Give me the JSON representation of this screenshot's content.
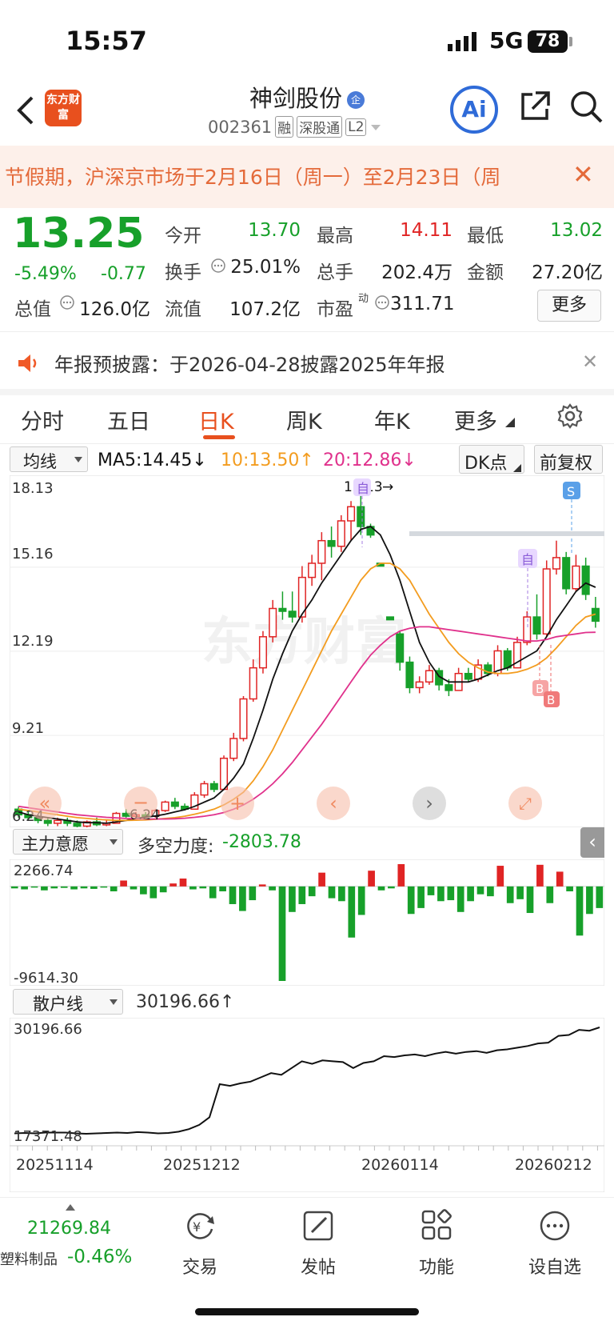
{
  "status": {
    "time": "15:57",
    "network": "5G",
    "battery": "78"
  },
  "header": {
    "logo": "东方财富",
    "title": "神剑股份",
    "badge": "企",
    "code": "002361",
    "tags": [
      "融",
      "深股通",
      "L2"
    ],
    "ai": "Ai"
  },
  "banner": {
    "text": "节假期，沪深京市场于2月16日（周一）至2月23日（周",
    "close": "✕"
  },
  "quote": {
    "price": "13.25",
    "pct": "-5.49%",
    "chg": "-0.77",
    "rows": [
      [
        {
          "k": "今开",
          "v": "13.70",
          "c": "#17a02a"
        },
        {
          "k": "最高",
          "v": "14.11",
          "c": "#e02424"
        },
        {
          "k": "最低",
          "v": "13.02",
          "c": "#17a02a"
        }
      ],
      [
        {
          "k": "换手",
          "v": "25.01%",
          "c": "#222"
        },
        {
          "k": "总手",
          "v": "202.4万",
          "c": "#222"
        },
        {
          "k": "金额",
          "v": "27.20亿",
          "c": "#222"
        }
      ],
      [
        {
          "k": "总值",
          "v": "126.0亿",
          "c": "#222"
        },
        {
          "k": "流值",
          "v": "107.2亿",
          "c": "#222"
        },
        {
          "k": "市盈",
          "v": "311.71",
          "c": "#222"
        }
      ]
    ],
    "more": "更多",
    "pe_sup": "动"
  },
  "announcement": {
    "text": "年报预披露：于2026-04-28披露2025年年报",
    "close": "✕"
  },
  "tabs": [
    "分时",
    "五日",
    "日K",
    "周K",
    "年K",
    "更多"
  ],
  "ma_bar": {
    "selector": "均线",
    "ma5": "MA5:14.45",
    "ma5_arrow": "↓",
    "ma10": "10:13.50",
    "ma10_arrow": "↑",
    "ma20": "20:12.86",
    "ma20_arrow": "↓",
    "dk": "DK点",
    "fq": "前复权"
  },
  "kchart": {
    "y_labels": [
      "18.13",
      "15.16",
      "12.19",
      "9.21",
      "6.24"
    ],
    "high_label": "18.13",
    "low_label": "6.24",
    "watermark": "东方财富",
    "signals": [
      "自",
      "自",
      "S",
      "B",
      "B"
    ]
  },
  "ind1": {
    "selector": "主力意愿",
    "label": "多空力度:",
    "value": "-2803.78",
    "max": "2266.74",
    "min": "-9614.30"
  },
  "ind2": {
    "selector": "散户线",
    "value": "30196.66",
    "arrow": "↑",
    "max": "30196.66",
    "min": "17371.48"
  },
  "dates": [
    "20251114",
    "20251212",
    "20260114",
    "20260212"
  ],
  "footer": {
    "index_value": "21269.84",
    "index_name": "塑料制品",
    "index_pct": "-0.46%",
    "items": [
      "交易",
      "发帖",
      "功能",
      "设自选"
    ]
  },
  "colors": {
    "up": "#e02424",
    "down": "#17a02a",
    "accent": "#e8501e",
    "ma5": "#111111",
    "ma10": "#f39c1f",
    "ma20": "#e0318c"
  },
  "chart_data": {
    "type": "candlestick",
    "ohlc": [
      [
        6.6,
        6.7,
        6.3,
        6.4
      ],
      [
        6.4,
        6.5,
        6.2,
        6.3
      ],
      [
        6.3,
        6.4,
        6.1,
        6.2
      ],
      [
        6.2,
        6.3,
        6.0,
        6.1
      ],
      [
        6.1,
        6.3,
        6.0,
        6.2
      ],
      [
        6.2,
        6.3,
        6.0,
        6.1
      ],
      [
        6.1,
        6.2,
        5.9,
        6.0
      ],
      [
        6.0,
        6.2,
        5.9,
        6.15
      ],
      [
        6.15,
        6.3,
        6.0,
        6.05
      ],
      [
        6.05,
        6.2,
        6.0,
        6.1
      ],
      [
        6.1,
        6.5,
        6.1,
        6.45
      ],
      [
        6.45,
        6.6,
        6.3,
        6.35
      ],
      [
        6.35,
        6.5,
        6.25,
        6.4
      ],
      [
        6.4,
        6.5,
        6.3,
        6.35
      ],
      [
        6.35,
        6.6,
        6.3,
        6.55
      ],
      [
        6.55,
        6.9,
        6.5,
        6.85
      ],
      [
        6.85,
        7.0,
        6.6,
        6.7
      ],
      [
        6.7,
        6.8,
        6.55,
        6.6
      ],
      [
        6.6,
        7.2,
        6.6,
        7.1
      ],
      [
        7.1,
        7.6,
        7.0,
        7.5
      ],
      [
        7.5,
        7.6,
        7.2,
        7.3
      ],
      [
        7.3,
        8.5,
        7.3,
        8.4
      ],
      [
        8.4,
        9.3,
        8.3,
        9.1
      ],
      [
        9.1,
        10.6,
        9.0,
        10.5
      ],
      [
        10.5,
        11.9,
        10.4,
        11.6
      ],
      [
        11.6,
        12.9,
        11.4,
        12.7
      ],
      [
        12.7,
        14.0,
        12.5,
        13.7
      ],
      [
        13.7,
        14.3,
        13.3,
        13.6
      ],
      [
        13.6,
        14.3,
        13.2,
        13.4
      ],
      [
        13.4,
        15.2,
        13.2,
        14.8
      ],
      [
        14.8,
        15.6,
        14.5,
        15.3
      ],
      [
        15.3,
        16.4,
        14.7,
        16.1
      ],
      [
        16.1,
        16.6,
        15.5,
        15.9
      ],
      [
        15.9,
        17.0,
        15.7,
        16.8
      ],
      [
        16.8,
        17.5,
        16.1,
        17.3
      ],
      [
        17.3,
        18.13,
        16.3,
        16.6
      ],
      [
        16.6,
        16.7,
        16.2,
        16.3
      ],
      [
        15.3,
        15.3,
        15.2,
        15.2
      ],
      [
        13.4,
        13.4,
        13.3,
        13.3
      ],
      [
        12.8,
        12.9,
        11.5,
        11.8
      ],
      [
        11.8,
        12.0,
        10.7,
        10.9
      ],
      [
        10.9,
        11.3,
        10.7,
        11.1
      ],
      [
        11.1,
        11.7,
        11.0,
        11.5
      ],
      [
        11.5,
        11.6,
        10.8,
        11.0
      ],
      [
        11.0,
        11.2,
        10.6,
        10.8
      ],
      [
        10.8,
        11.6,
        10.8,
        11.4
      ],
      [
        11.4,
        11.6,
        11.1,
        11.2
      ],
      [
        11.2,
        11.9,
        11.1,
        11.7
      ],
      [
        11.7,
        11.8,
        11.3,
        11.4
      ],
      [
        11.4,
        12.4,
        11.3,
        12.2
      ],
      [
        12.2,
        12.3,
        11.5,
        11.6
      ],
      [
        11.6,
        12.7,
        11.6,
        12.5
      ],
      [
        12.5,
        13.6,
        12.4,
        13.4
      ],
      [
        13.4,
        14.2,
        12.6,
        12.8
      ],
      [
        12.8,
        15.4,
        12.7,
        15.1
      ],
      [
        15.1,
        16.1,
        14.9,
        15.5
      ],
      [
        15.5,
        15.7,
        14.2,
        14.4
      ],
      [
        14.4,
        15.6,
        14.3,
        15.2
      ],
      [
        15.2,
        15.5,
        14.0,
        14.2
      ],
      [
        13.7,
        14.11,
        13.02,
        13.25
      ]
    ],
    "ma5": [
      6.5,
      6.4,
      6.35,
      6.3,
      6.25,
      6.2,
      6.15,
      6.12,
      6.12,
      6.1,
      6.15,
      6.2,
      6.27,
      6.32,
      6.36,
      6.42,
      6.5,
      6.58,
      6.7,
      6.85,
      7.0,
      7.3,
      7.7,
      8.2,
      9.1,
      10.1,
      11.2,
      12.1,
      12.9,
      13.5,
      14.0,
      14.6,
      15.1,
      15.6,
      16.1,
      16.5,
      16.6,
      16.3,
      15.6,
      14.7,
      13.6,
      12.5,
      11.8,
      11.3,
      11.1,
      11.1,
      11.1,
      11.2,
      11.35,
      11.5,
      11.6,
      11.8,
      12.0,
      12.2,
      12.7,
      13.3,
      13.8,
      14.3,
      14.6,
      14.45
    ],
    "ma10": [
      6.6,
      6.55,
      6.5,
      6.45,
      6.4,
      6.35,
      6.3,
      6.27,
      6.24,
      6.22,
      6.2,
      6.2,
      6.21,
      6.22,
      6.24,
      6.27,
      6.3,
      6.35,
      6.42,
      6.5,
      6.6,
      6.75,
      6.95,
      7.2,
      7.6,
      8.1,
      8.7,
      9.4,
      10.1,
      10.8,
      11.5,
      12.2,
      12.9,
      13.5,
      14.1,
      14.7,
      15.1,
      15.3,
      15.3,
      15.1,
      14.7,
      14.1,
      13.5,
      13.0,
      12.5,
      12.1,
      11.8,
      11.6,
      11.45,
      11.4,
      11.4,
      11.45,
      11.55,
      11.7,
      11.95,
      12.3,
      12.7,
      13.1,
      13.4,
      13.5
    ],
    "ma20": [
      6.7,
      6.65,
      6.6,
      6.55,
      6.5,
      6.45,
      6.4,
      6.37,
      6.34,
      6.31,
      6.29,
      6.27,
      6.26,
      6.25,
      6.25,
      6.25,
      6.26,
      6.28,
      6.31,
      6.35,
      6.4,
      6.48,
      6.6,
      6.75,
      6.95,
      7.2,
      7.5,
      7.85,
      8.25,
      8.7,
      9.15,
      9.6,
      10.1,
      10.6,
      11.1,
      11.6,
      12.05,
      12.4,
      12.7,
      12.9,
      13.0,
      13.05,
      13.05,
      13.0,
      12.95,
      12.9,
      12.85,
      12.8,
      12.75,
      12.7,
      12.65,
      12.6,
      12.55,
      12.55,
      12.6,
      12.7,
      12.75,
      12.8,
      12.85,
      12.86
    ],
    "main_force": [
      -200,
      -300,
      -100,
      -400,
      -200,
      -150,
      -300,
      -200,
      -250,
      -100,
      -500,
      600,
      -300,
      -800,
      -1200,
      -600,
      300,
      800,
      -300,
      -200,
      -1200,
      -500,
      -1800,
      -2500,
      -1400,
      200,
      -400,
      -9614,
      -2600,
      -1800,
      -1000,
      1400,
      -1200,
      -1500,
      -5200,
      -2900,
      1600,
      -400,
      -200,
      2266,
      -2800,
      -2200,
      -900,
      -1500,
      -1400,
      -2600,
      -1500,
      -800,
      -1000,
      2100,
      -1700,
      -1300,
      -2700,
      2200,
      -1700,
      1500,
      -500,
      -5000,
      -2800,
      -2200
    ],
    "retail": [
      17700,
      17750,
      17700,
      17800,
      17800,
      17800,
      17700,
      17650,
      17700,
      17750,
      17800,
      17750,
      17850,
      17800,
      17700,
      17750,
      17900,
      18200,
      18700,
      19600,
      23500,
      23300,
      23600,
      23800,
      24300,
      24800,
      24600,
      25400,
      26200,
      25900,
      26300,
      26200,
      26100,
      25400,
      26000,
      26200,
      26800,
      26700,
      26900,
      27000,
      26800,
      27100,
      27300,
      27100,
      27300,
      27400,
      27200,
      27500,
      27600,
      27800,
      28000,
      28300,
      28400,
      29200,
      29300,
      29900,
      29800,
      30196
    ],
    "y_range": [
      6.24,
      18.13
    ]
  }
}
